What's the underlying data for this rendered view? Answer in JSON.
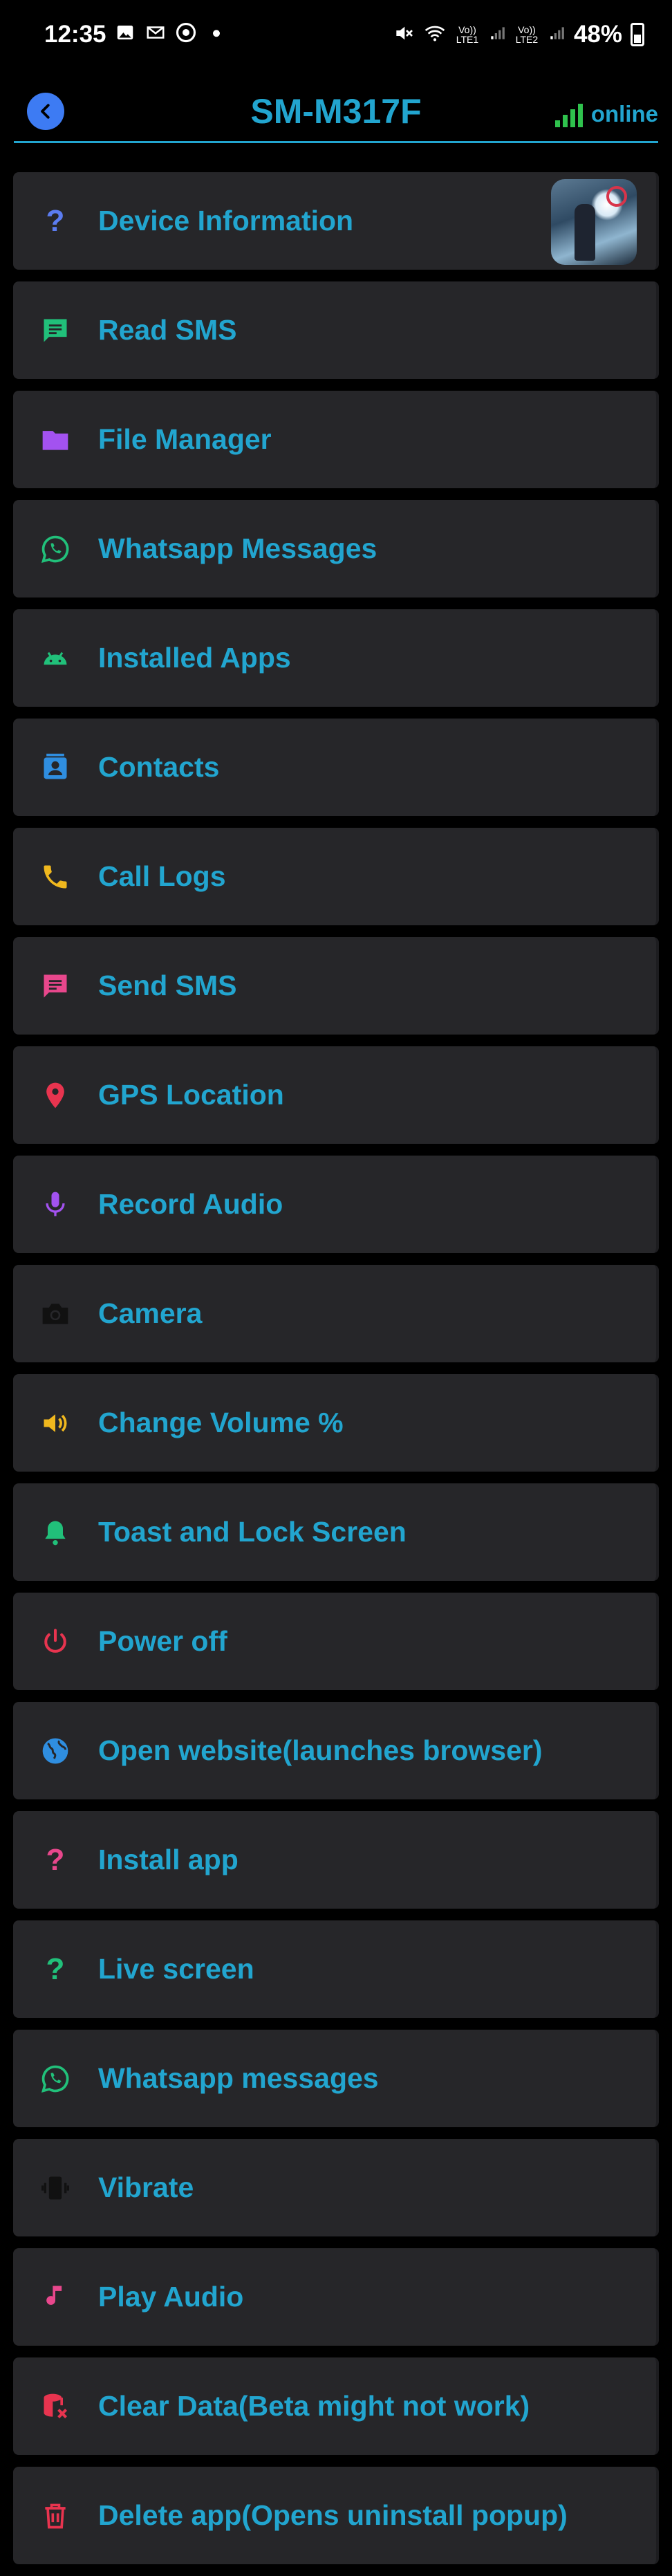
{
  "status_bar": {
    "time": "12:35",
    "battery_percent": "48%",
    "volte1": "Vo)) LTE1",
    "volte2": "Vo)) LTE2",
    "left_icons": [
      "image-icon",
      "gmail-icon",
      "chrome-icon",
      "dot-icon"
    ],
    "right_icons": [
      "mute-icon",
      "wifi-icon",
      "signal-sim1-icon",
      "signal-sim2-icon",
      "battery-icon"
    ]
  },
  "header": {
    "title": "SM-M317F",
    "status_label": "online",
    "back_icon": "back-arrow-icon",
    "accent_color": "#22a5cf",
    "online_color": "#2fc24d"
  },
  "menu": {
    "items": [
      {
        "label": "Device Information",
        "icon": "question-icon",
        "color": "#5b7cf0"
      },
      {
        "label": "Read SMS",
        "icon": "message-icon",
        "color": "#21c07a"
      },
      {
        "label": "File Manager",
        "icon": "folder-icon",
        "color": "#a352f0"
      },
      {
        "label": "Whatsapp Messages",
        "icon": "whatsapp-icon",
        "color": "#21c07a"
      },
      {
        "label": "Installed Apps",
        "icon": "android-icon",
        "color": "#21c07a"
      },
      {
        "label": "Contacts",
        "icon": "contacts-icon",
        "color": "#2f8ee0"
      },
      {
        "label": "Call Logs",
        "icon": "phone-icon",
        "color": "#f0b81e"
      },
      {
        "label": "Send SMS",
        "icon": "chat-icon",
        "color": "#e8478c"
      },
      {
        "label": "GPS Location",
        "icon": "location-pin-icon",
        "color": "#e8344f"
      },
      {
        "label": "Record Audio",
        "icon": "microphone-icon",
        "color": "#a352f0"
      },
      {
        "label": "Camera",
        "icon": "camera-icon",
        "color": "#151515"
      },
      {
        "label": "Change Volume %",
        "icon": "volume-icon",
        "color": "#f0b81e"
      },
      {
        "label": "Toast and Lock Screen",
        "icon": "bell-icon",
        "color": "#21c07a"
      },
      {
        "label": "Power off",
        "icon": "power-icon",
        "color": "#e8344f"
      },
      {
        "label": "Open website(launches browser)",
        "icon": "globe-icon",
        "color": "#2f8ee0"
      },
      {
        "label": "Install app",
        "icon": "question-icon",
        "color": "#e8478c"
      },
      {
        "label": "Live screen",
        "icon": "question-icon",
        "color": "#21c07a"
      },
      {
        "label": "Whatsapp messages",
        "icon": "whatsapp-icon",
        "color": "#21c07a"
      },
      {
        "label": "Vibrate",
        "icon": "vibrate-icon",
        "color": "#151515"
      },
      {
        "label": "Play Audio",
        "icon": "music-note-icon",
        "color": "#e8478c"
      },
      {
        "label": "Clear Data(Beta might not work)",
        "icon": "database-remove-icon",
        "color": "#e8344f"
      },
      {
        "label": "Delete app(Opens uninstall popup)",
        "icon": "trash-icon",
        "color": "#e8344f"
      }
    ]
  }
}
